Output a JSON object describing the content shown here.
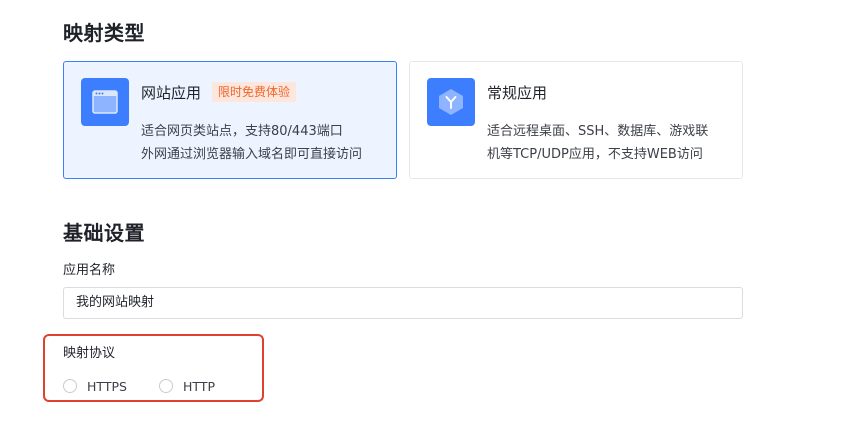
{
  "sections": {
    "mapping_type_title": "映射类型",
    "basic_settings_title": "基础设置"
  },
  "cards": {
    "web": {
      "name": "网站应用",
      "badge": "限时免费体验",
      "desc_line1": "适合网页类站点，支持80/443端口",
      "desc_line2": "外网通过浏览器输入域名即可直接访问",
      "icon": "browser-window-icon",
      "selected": true
    },
    "general": {
      "name": "常规应用",
      "desc_line1": "适合远程桌面、SSH、数据库、游戏联",
      "desc_line2": "机等TCP/UDP应用，不支持WEB访问",
      "icon": "hexagon-y-icon",
      "selected": false
    }
  },
  "fields": {
    "app_name_label": "应用名称",
    "app_name_value": "我的网站映射",
    "protocol_label": "映射协议",
    "protocol_options": [
      "HTTPS",
      "HTTP"
    ]
  },
  "colors": {
    "accent": "#3d7eff",
    "selected_bg": "#edf3ff",
    "badge_bg": "#fde6dc",
    "badge_text": "#f0652c",
    "highlight": "#e0412c"
  }
}
